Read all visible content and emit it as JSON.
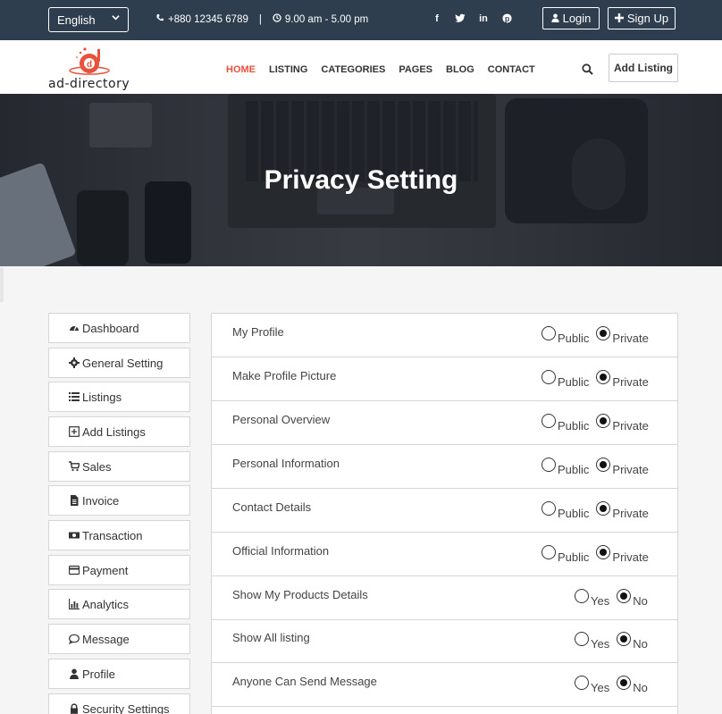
{
  "topbar": {
    "language": "English",
    "phone": "+880 12345 6789",
    "separator": "|",
    "hours": "9.00 am - 5.00 pm",
    "socials": [
      "facebook-icon",
      "twitter-icon",
      "linkedin-icon",
      "pinterest-icon"
    ],
    "login_label": "Login",
    "signup_label": "Sign Up"
  },
  "header": {
    "logo_text": "ad-directory",
    "nav": [
      "HOME",
      "LISTING",
      "CATEGORIES",
      "PAGES",
      "BLOG",
      "CONTACT"
    ],
    "active_nav": "HOME",
    "add_listing_label": "Add Listing"
  },
  "banner": {
    "title": "Privacy Setting"
  },
  "sidebar": {
    "items": [
      {
        "label": "Dashboard",
        "icon": "dashboard-icon"
      },
      {
        "label": "General Setting",
        "icon": "gear-icon"
      },
      {
        "label": "Listings",
        "icon": "list-icon"
      },
      {
        "label": "Add Listings",
        "icon": "plus-square-icon"
      },
      {
        "label": "Sales",
        "icon": "cart-icon"
      },
      {
        "label": "Invoice",
        "icon": "file-icon"
      },
      {
        "label": "Transaction",
        "icon": "money-icon"
      },
      {
        "label": "Payment",
        "icon": "credit-card-icon"
      },
      {
        "label": "Analytics",
        "icon": "bar-chart-icon"
      },
      {
        "label": "Message",
        "icon": "comment-icon"
      },
      {
        "label": "Profile",
        "icon": "user-icon"
      },
      {
        "label": "Security Settings",
        "icon": "lock-icon"
      }
    ]
  },
  "privacy": {
    "rows": [
      {
        "label": "My Profile",
        "options": [
          "Public",
          "Private"
        ],
        "selected": "Private"
      },
      {
        "label": "Make Profile Picture",
        "options": [
          "Public",
          "Private"
        ],
        "selected": "Private"
      },
      {
        "label": "Personal Overview",
        "options": [
          "Public",
          "Private"
        ],
        "selected": "Private"
      },
      {
        "label": "Personal Information",
        "options": [
          "Public",
          "Private"
        ],
        "selected": "Private"
      },
      {
        "label": "Contact Details",
        "options": [
          "Public",
          "Private"
        ],
        "selected": "Private"
      },
      {
        "label": "Official Information",
        "options": [
          "Public",
          "Private"
        ],
        "selected": "Private"
      },
      {
        "label": "Show My Products Details",
        "options": [
          "Yes",
          "No"
        ],
        "selected": "No"
      },
      {
        "label": "Show All listing",
        "options": [
          "Yes",
          "No"
        ],
        "selected": "No"
      },
      {
        "label": "Anyone Can Send Message",
        "options": [
          "Yes",
          "No"
        ],
        "selected": "No"
      }
    ]
  },
  "colors": {
    "topbar_bg": "#2f3e4e",
    "accent": "#e8513c"
  }
}
